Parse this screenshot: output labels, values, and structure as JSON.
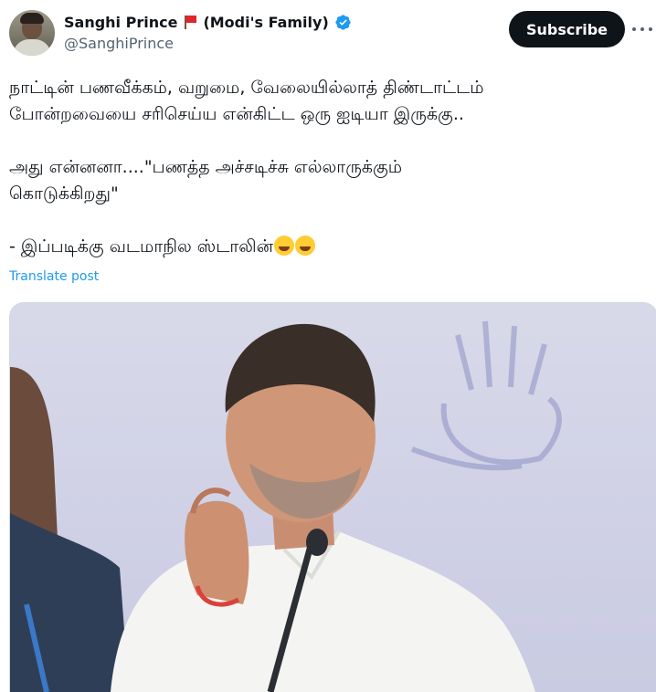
{
  "author": {
    "display_name": "Sanghi Prince",
    "name_suffix": "(Modi's Family)",
    "handle": "@SanghiPrince",
    "flag_icon": "red-flag-icon",
    "verified_icon": "verified-badge-icon",
    "verified_color": "#1d9bf0"
  },
  "header": {
    "subscribe_label": "Subscribe",
    "more_icon": "more-horizontal-icon"
  },
  "tweet": {
    "lines": [
      "நாட்டின் பணவீக்கம், வறுமை, வேலையில்லாத் திண்டாட்டம்",
      "போன்றவையை சரிசெய்ய என்கிட்ட ஒரு ஐடியா இருக்கு..",
      "அது என்னனா....\"பணத்த அச்சடிச்சு எல்லாருக்கும்",
      "கொடுக்கிறது\"",
      "- இப்படிக்கு வடமாநில ஸ்டாலின்"
    ],
    "emojis": [
      "face-with-tears-of-joy-emoji",
      "sneezing-face-emoji"
    ],
    "translate_label": "Translate post"
  },
  "media": {
    "type": "video-thumbnail",
    "accent_colors": {
      "background": "#d0d2e6",
      "shirt": "#f4f4f2",
      "mic": "#2b2f33"
    }
  }
}
